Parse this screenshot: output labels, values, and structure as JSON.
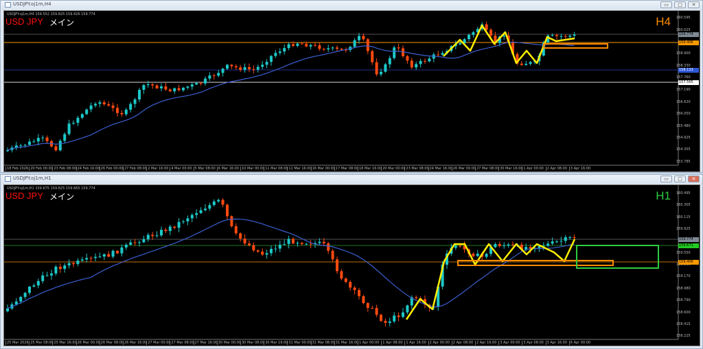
{
  "top": {
    "window_title": "USDJPY.oj1m,H4",
    "info": "USDJPY.oj1m,H4  159.552 159.825 159.426 159.774",
    "symbol": "USD JPY",
    "label": "メイン",
    "timeframe": "H4",
    "tf_color": "#ff8c00",
    "price_labels": [
      "160.595",
      "160.025",
      "158.900",
      "158.330",
      "157.760",
      "157.190",
      "156.620",
      "156.050",
      "155.480",
      "154.925",
      "154.355",
      "153.785"
    ],
    "price_boxes": [
      {
        "value": "159.774",
        "bg": "#7f8a96",
        "fg": "#000"
      },
      {
        "value": "159.406",
        "bg": "#ff9a00",
        "fg": "#000"
      },
      {
        "value": "158.133",
        "bg": "#2f58d8",
        "fg": "#fff"
      },
      {
        "value": "157.565",
        "bg": "#ffffff",
        "fg": "#000"
      }
    ],
    "time_labels": [
      "18 Feb 2026",
      "20 Feb 00:00",
      "23 Feb 08:00",
      "24 Feb 16:00",
      "26 Feb 00:00",
      "27 Feb 08:00",
      "2 Mar 16:00",
      "4 Mar 00:00",
      "5 Mar 08:00",
      "6 Mar 16:00",
      "10 Mar 00:00",
      "11 Mar 08:00",
      "12 Mar 16:00",
      "16 Mar 00:00",
      "17 Mar 08:00",
      "18 Mar 16:00",
      "20 Mar 00:00",
      "23 Mar 08:00",
      "24 Mar 16:00",
      "26 Mar 00:00",
      "27 Mar 08:00",
      "30 Mar 16:00",
      "1 Apr 00:00",
      "2 Apr 08:00",
      "3 Apr 16:00"
    ]
  },
  "bottom": {
    "window_title": "USDJPY.oj1m,H1",
    "info": "USDJPY.oj1m,H1  159.675 159.825 159.665 159.774",
    "symbol": "USD JPY",
    "label": "メイン",
    "timeframe": "H1",
    "tf_color": "#2ecc40",
    "price_labels": [
      "160.495",
      "160.305",
      "160.115",
      "159.925",
      "159.550",
      "159.360",
      "159.170",
      "158.980",
      "158.790",
      "158.600",
      "158.415",
      "158.225"
    ],
    "price_boxes": [
      {
        "value": "159.774",
        "bg": "#7f8a96",
        "fg": "#000"
      },
      {
        "value": "159.671",
        "bg": "#22cc22",
        "fg": "#000"
      },
      {
        "value": "159.406",
        "bg": "#ff9a00",
        "fg": "#000"
      }
    ],
    "time_labels": [
      "25 Mar 2026",
      "25 Mar 08:00",
      "25 Mar 16:00",
      "26 Mar 00:00",
      "26 Mar 08:00",
      "26 Mar 16:00",
      "27 Mar 00:00",
      "27 Mar 08:00",
      "27 Mar 16:00",
      "30 Mar 00:00",
      "30 Mar 08:00",
      "30 Mar 16:00",
      "31 Mar 00:00",
      "31 Mar 08:00",
      "31 Mar 16:00",
      "1 Apr 00:00",
      "1 Apr 08:00",
      "1 Apr 16:00",
      "2 Apr 00:00",
      "2 Apr 08:00",
      "2 Apr 16:00",
      "3 Apr 00:00",
      "3 Apr 08:00",
      "3 Apr 16:00",
      "6 Apr 00:00"
    ]
  },
  "buttons": {
    "minimize": "▭",
    "maximize": "□",
    "close": "✕"
  },
  "colors": {
    "bull": "#1ec8c8",
    "bear": "#ff4a10",
    "ma": "#3b5fd0",
    "zigzag": "#ffee00"
  }
}
